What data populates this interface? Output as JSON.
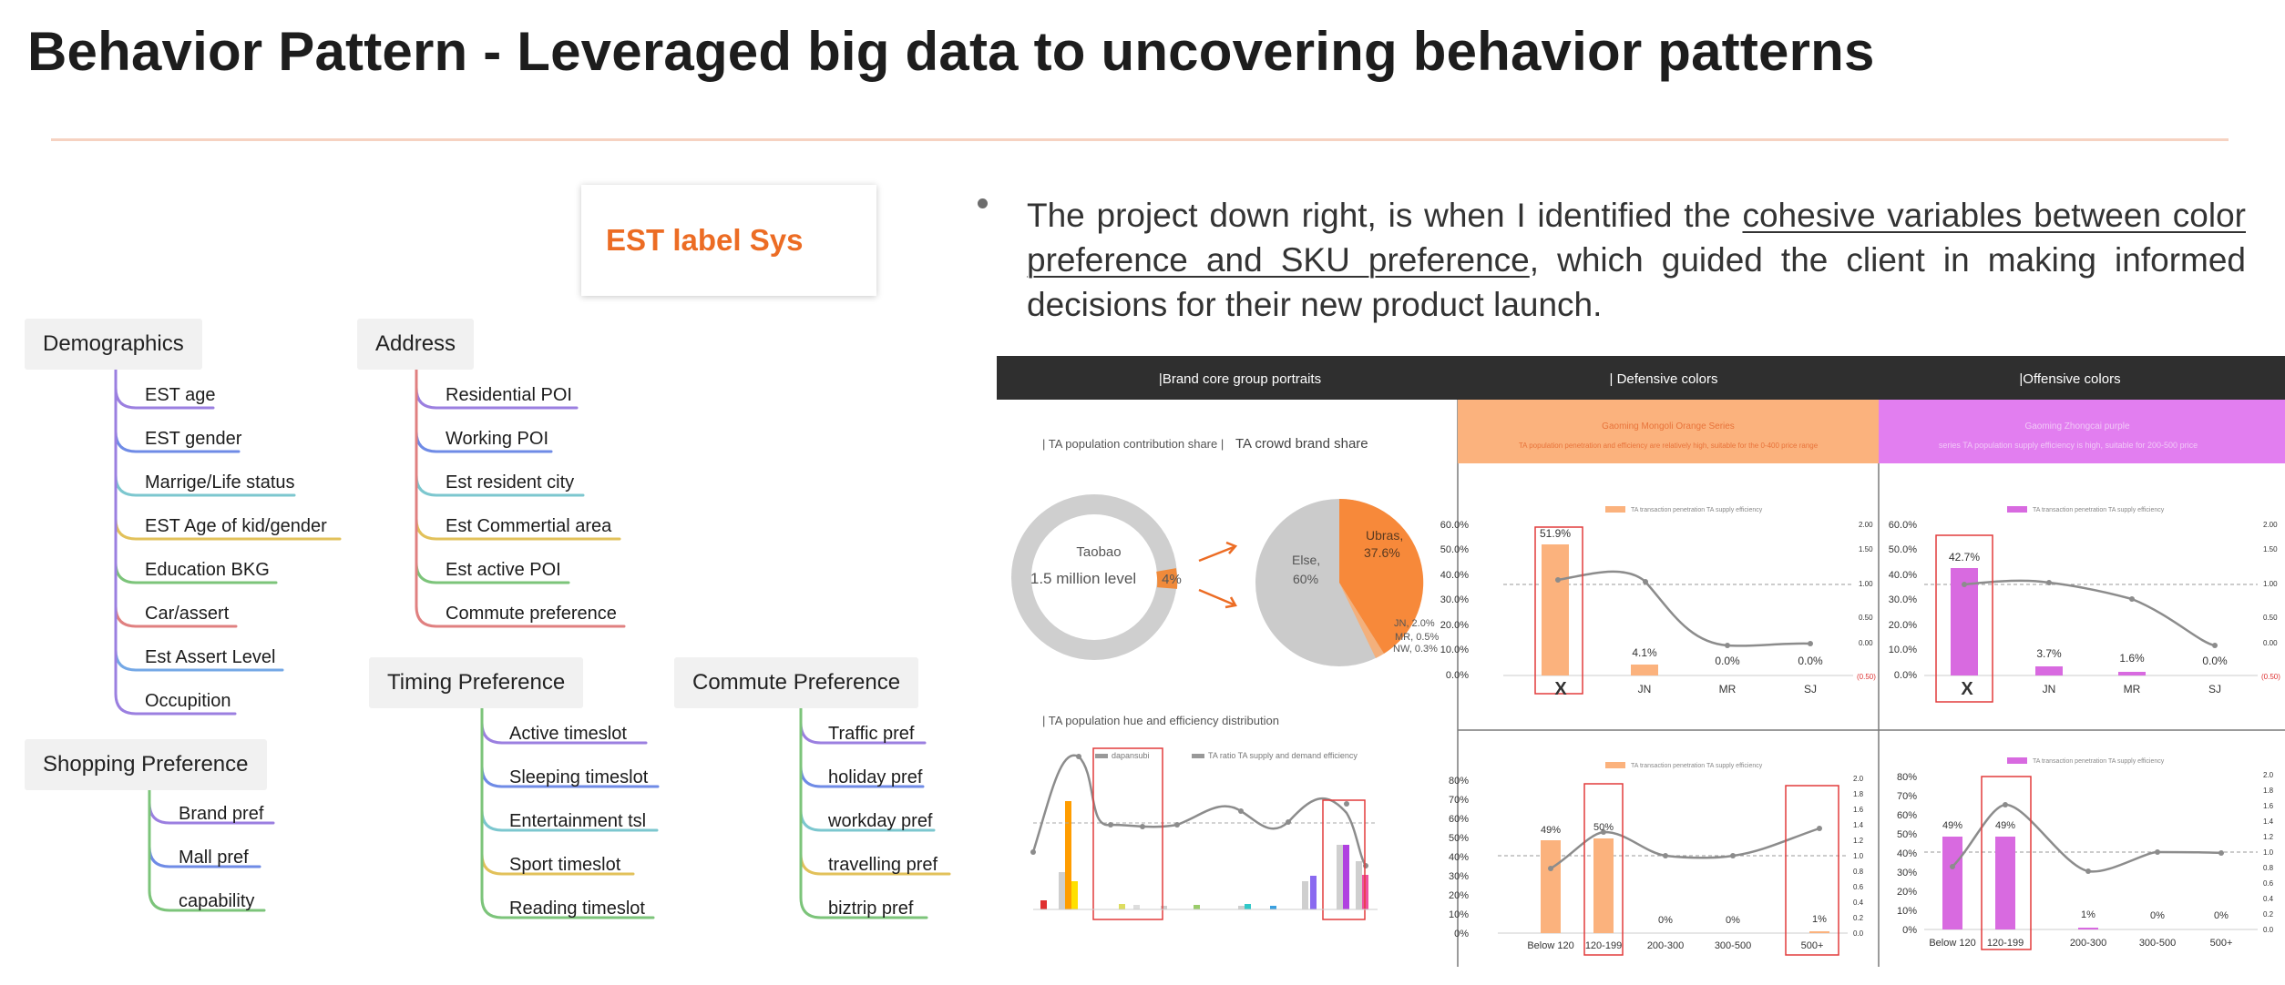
{
  "title": "Behavior Pattern - Leveraged big data to uncovering behavior patterns",
  "est_label": "EST label Sys",
  "categories": {
    "demographics": {
      "label": "Demographics",
      "items": [
        "EST age",
        "EST gender",
        "Marrige/Life status",
        "EST Age of kid/gender",
        "Education BKG",
        "Car/assert",
        "Est Assert Level",
        "Occupition"
      ]
    },
    "address": {
      "label": "Address",
      "items": [
        "Residential POI",
        "Working POI",
        "Est resident city",
        "Est Commertial area",
        "Est active POI",
        "Commute preference"
      ]
    },
    "shopping": {
      "label": "Shopping Preference",
      "items": [
        "Brand pref",
        "Mall pref",
        "capability"
      ]
    },
    "timing": {
      "label": "Timing Preference",
      "items": [
        "Active timeslot",
        "Sleeping timeslot",
        "Entertainment tsl",
        "Sport timeslot",
        "Reading timeslot"
      ]
    },
    "commute": {
      "label": "Commute Preference",
      "items": [
        "Traffic pref",
        "holiday pref",
        "workday pref",
        "travelling pref",
        "biztrip pref"
      ]
    }
  },
  "branch_colors": [
    "#9b7fe0",
    "#6f8be6",
    "#7cc7cf",
    "#e2c15a",
    "#7cc47a",
    "#e08080",
    "#74a8e6",
    "#9b7fe0"
  ],
  "paragraph": {
    "pre": "The project down right, is when I identified the ",
    "link": "cohesive variables between color preference and SKU preference",
    "post": ", which guided the client in making informed decisions for their new product launch."
  },
  "report": {
    "headers": [
      "|Brand core group portraits",
      "| Defensive colors",
      "|Offensive colors"
    ],
    "portrait": {
      "subtitle_left": "| TA population contribution share |",
      "subtitle_right": "TA crowd brand share",
      "donut_label_1": "Taobao",
      "donut_label_2": "1.5 million level",
      "donut_pct": "4%",
      "pie_ubras": "Ubras,",
      "pie_ubras_pct": "37.6%",
      "pie_else": "Else,",
      "pie_else_pct": "60%",
      "pie_jn": "JN, 2.0%",
      "pie_mr": "MR, 0.5%",
      "pie_nw": "NW, 0.3%",
      "hue_title": "| TA population hue and efficiency distribution",
      "hue_legend_1": "dapansubi",
      "hue_legend_2": "TA ratio TA supply and demand efficiency"
    },
    "defensive": {
      "banner_line1": "Gaoming Mongoli Orange Series",
      "banner_line2": "TA population penetration and efficiency are relatively high, suitable for the 0-400 price range",
      "legend": "TA transaction penetration  TA supply efficiency",
      "brands": [
        "X",
        "JN",
        "MR",
        "SJ"
      ],
      "brand_values": [
        "51.9%",
        "4.1%",
        "0.0%",
        "0.0%"
      ],
      "left_ticks": [
        "60.0%",
        "50.0%",
        "40.0%",
        "30.0%",
        "20.0%",
        "10.0%",
        "0.0%"
      ],
      "right_ticks": [
        "2.00",
        "1.50",
        "1.00",
        "0.50",
        "0.00",
        "(0.50)"
      ],
      "price_values": [
        "49%",
        "50%",
        "0%",
        "0%",
        "1%"
      ]
    },
    "offensive": {
      "banner_line1": "Gaoming Zhongcai purple",
      "banner_line2": "series TA population supply efficiency is high, suitable for 200-500 price",
      "legend": "TA transaction penetration  TA supply efficiency",
      "brands": [
        "X",
        "JN",
        "MR",
        "SJ"
      ],
      "brand_values": [
        "42.7%",
        "3.7%",
        "1.6%",
        "0.0%"
      ],
      "left_ticks": [
        "60.0%",
        "50.0%",
        "40.0%",
        "30.0%",
        "20.0%",
        "10.0%",
        "0.0%"
      ],
      "right_ticks": [
        "2.00",
        "1.50",
        "1.00",
        "0.50",
        "0.00",
        "(0.50)"
      ],
      "price_values": [
        "49%",
        "49%",
        "1%",
        "0%",
        "0%"
      ]
    },
    "price_bands": [
      "Below 120",
      "120-199",
      "200-300",
      "300-500",
      "500+"
    ],
    "price_left_ticks": [
      "80%",
      "70%",
      "60%",
      "50%",
      "40%",
      "30%",
      "20%",
      "10%",
      "0%"
    ],
    "price_right_ticks": [
      "2.0",
      "1.8",
      "1.6",
      "1.4",
      "1.2",
      "1.0",
      "0.8",
      "0.6",
      "0.4",
      "0.2",
      "0.0"
    ]
  },
  "colors": {
    "accent": "#ec6c24",
    "orange_bar": "#fbb27d",
    "purple_bar": "#d86ae0",
    "header_bg": "#2f2f2f",
    "highlight": "#e23c3c"
  }
}
